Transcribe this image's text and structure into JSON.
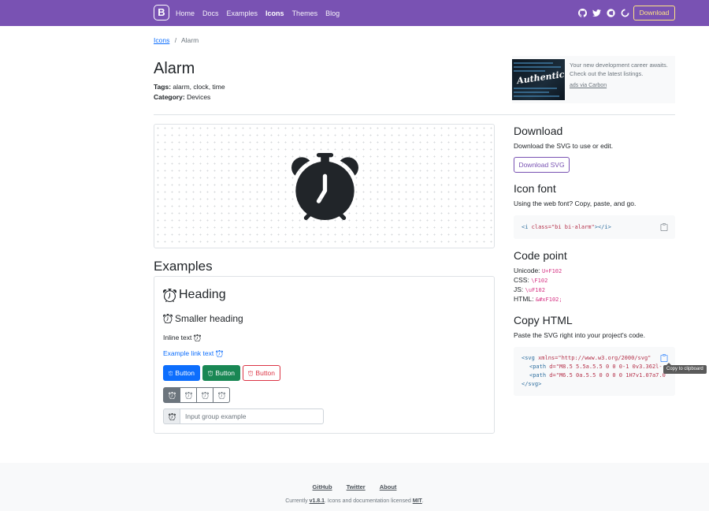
{
  "navbar": {
    "brand": "B",
    "links": [
      "Home",
      "Docs",
      "Examples",
      "Icons",
      "Themes",
      "Blog"
    ],
    "active_link": "Icons",
    "icons": [
      "github-icon",
      "twitter-icon",
      "opencollective-icon",
      "slack-icon"
    ],
    "download_label": "Download"
  },
  "breadcrumb": {
    "parent": "Icons",
    "separator": "/",
    "current": "Alarm"
  },
  "icon": {
    "title": "Alarm",
    "tags_label": "Tags:",
    "tags": "alarm, clock, time",
    "category_label": "Category:",
    "category": "Devices"
  },
  "ad": {
    "image_text": "Authentic",
    "text": "Your new development career awaits. Check out the latest listings.",
    "link": "ads via Carbon"
  },
  "examples": {
    "title": "Examples",
    "heading": "Heading",
    "smaller_heading": "Smaller heading",
    "inline_text": "Inline text",
    "link_text": "Example link text",
    "button_label": "Button",
    "input_placeholder": "Input group example"
  },
  "download": {
    "title": "Download",
    "desc": "Download the SVG to use or edit.",
    "button": "Download SVG"
  },
  "icon_font": {
    "title": "Icon font",
    "desc": "Using the web font? Copy, paste, and go.",
    "code_open": "<i ",
    "code_attr": "class=",
    "code_val": "\"bi bi-alarm\"",
    "code_close": "></i>"
  },
  "code_point": {
    "title": "Code point",
    "unicode_label": "Unicode:",
    "unicode": "U+F102",
    "css_label": "CSS:",
    "css": "\\F102",
    "js_label": "JS:",
    "js": "\\uF102",
    "html_label": "HTML:",
    "html": "&#xF102;"
  },
  "copy_html": {
    "title": "Copy HTML",
    "desc": "Paste the SVG right into your project's code.",
    "line1_tag": "<svg ",
    "line1_attr": "xmlns=",
    "line1_val": "\"http://www.w3.org/2000/svg\"",
    "line2_tag": "<path ",
    "line2_attr": "d=",
    "line2_val": "\"M8.5 5.5a.5.5 0 0 0-1 0v3.362l-",
    "line3_tag": "<path ",
    "line3_attr": "d=",
    "line3_val": "\"M6.5 0a.5.5 0 0 0 0 1H7v1.07a7.0",
    "line4": "</svg>",
    "tooltip": "Copy to clipboard"
  },
  "footer": {
    "links": [
      "GitHub",
      "Twitter",
      "About"
    ],
    "text_prefix": "Currently ",
    "version": "v1.8.1",
    "text_mid": ". Icons and documentation licensed ",
    "license": "MIT",
    "text_suffix": "."
  },
  "colors": {
    "brand_purple": "#7952b3",
    "download_yellow": "#ffe484",
    "primary": "#0d6efd",
    "success": "#198754",
    "danger": "#dc3545",
    "secondary": "#6c757d"
  }
}
